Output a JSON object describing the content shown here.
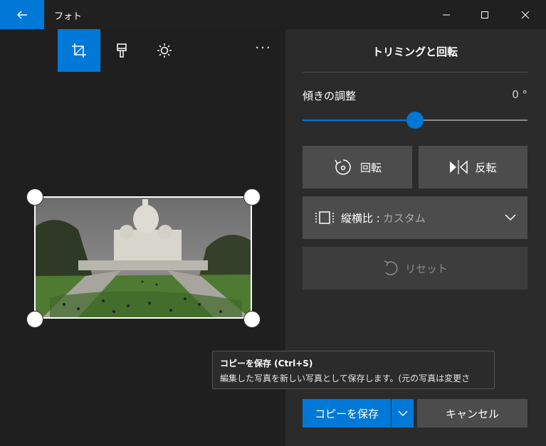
{
  "window": {
    "title": "フォト"
  },
  "panel": {
    "title": "トリミングと回転",
    "tilt_label": "傾きの調整",
    "tilt_value": "0 °",
    "tilt_level": 0.5,
    "rotate_label": "回転",
    "flip_label": "反転",
    "aspect_label": "縦横比 :",
    "aspect_value": "カスタム",
    "reset_label": "リセット"
  },
  "tooltip": {
    "title": "コピーを保存 (Ctrl+S)",
    "description": "編集した写真を新しい写真として保存します。(元の写真は変更さ"
  },
  "footer": {
    "save_copy_label": "コピーを保存",
    "cancel_label": "キャンセル"
  },
  "toolbar": {
    "icons": [
      "crop-icon",
      "filter-brush-icon",
      "brightness-icon",
      "more-icon"
    ],
    "more_label": "···"
  },
  "colors": {
    "accent": "#0078d7",
    "panel": "#2b2b2b",
    "canvas": "#1f1f1f"
  }
}
